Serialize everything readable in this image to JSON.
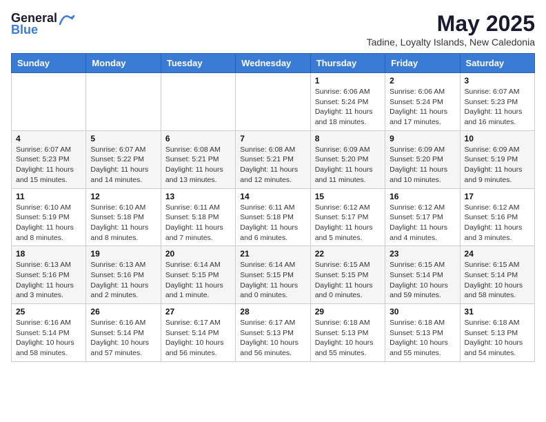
{
  "logo": {
    "general": "General",
    "blue": "Blue"
  },
  "header": {
    "month_title": "May 2025",
    "subtitle": "Tadine, Loyalty Islands, New Caledonia"
  },
  "weekdays": [
    "Sunday",
    "Monday",
    "Tuesday",
    "Wednesday",
    "Thursday",
    "Friday",
    "Saturday"
  ],
  "weeks": [
    [
      {
        "day": "",
        "sunrise": "",
        "sunset": "",
        "daylight": ""
      },
      {
        "day": "",
        "sunrise": "",
        "sunset": "",
        "daylight": ""
      },
      {
        "day": "",
        "sunrise": "",
        "sunset": "",
        "daylight": ""
      },
      {
        "day": "",
        "sunrise": "",
        "sunset": "",
        "daylight": ""
      },
      {
        "day": "1",
        "sunrise": "Sunrise: 6:06 AM",
        "sunset": "Sunset: 5:24 PM",
        "daylight": "Daylight: 11 hours and 18 minutes."
      },
      {
        "day": "2",
        "sunrise": "Sunrise: 6:06 AM",
        "sunset": "Sunset: 5:24 PM",
        "daylight": "Daylight: 11 hours and 17 minutes."
      },
      {
        "day": "3",
        "sunrise": "Sunrise: 6:07 AM",
        "sunset": "Sunset: 5:23 PM",
        "daylight": "Daylight: 11 hours and 16 minutes."
      }
    ],
    [
      {
        "day": "4",
        "sunrise": "Sunrise: 6:07 AM",
        "sunset": "Sunset: 5:23 PM",
        "daylight": "Daylight: 11 hours and 15 minutes."
      },
      {
        "day": "5",
        "sunrise": "Sunrise: 6:07 AM",
        "sunset": "Sunset: 5:22 PM",
        "daylight": "Daylight: 11 hours and 14 minutes."
      },
      {
        "day": "6",
        "sunrise": "Sunrise: 6:08 AM",
        "sunset": "Sunset: 5:21 PM",
        "daylight": "Daylight: 11 hours and 13 minutes."
      },
      {
        "day": "7",
        "sunrise": "Sunrise: 6:08 AM",
        "sunset": "Sunset: 5:21 PM",
        "daylight": "Daylight: 11 hours and 12 minutes."
      },
      {
        "day": "8",
        "sunrise": "Sunrise: 6:09 AM",
        "sunset": "Sunset: 5:20 PM",
        "daylight": "Daylight: 11 hours and 11 minutes."
      },
      {
        "day": "9",
        "sunrise": "Sunrise: 6:09 AM",
        "sunset": "Sunset: 5:20 PM",
        "daylight": "Daylight: 11 hours and 10 minutes."
      },
      {
        "day": "10",
        "sunrise": "Sunrise: 6:09 AM",
        "sunset": "Sunset: 5:19 PM",
        "daylight": "Daylight: 11 hours and 9 minutes."
      }
    ],
    [
      {
        "day": "11",
        "sunrise": "Sunrise: 6:10 AM",
        "sunset": "Sunset: 5:19 PM",
        "daylight": "Daylight: 11 hours and 8 minutes."
      },
      {
        "day": "12",
        "sunrise": "Sunrise: 6:10 AM",
        "sunset": "Sunset: 5:18 PM",
        "daylight": "Daylight: 11 hours and 8 minutes."
      },
      {
        "day": "13",
        "sunrise": "Sunrise: 6:11 AM",
        "sunset": "Sunset: 5:18 PM",
        "daylight": "Daylight: 11 hours and 7 minutes."
      },
      {
        "day": "14",
        "sunrise": "Sunrise: 6:11 AM",
        "sunset": "Sunset: 5:18 PM",
        "daylight": "Daylight: 11 hours and 6 minutes."
      },
      {
        "day": "15",
        "sunrise": "Sunrise: 6:12 AM",
        "sunset": "Sunset: 5:17 PM",
        "daylight": "Daylight: 11 hours and 5 minutes."
      },
      {
        "day": "16",
        "sunrise": "Sunrise: 6:12 AM",
        "sunset": "Sunset: 5:17 PM",
        "daylight": "Daylight: 11 hours and 4 minutes."
      },
      {
        "day": "17",
        "sunrise": "Sunrise: 6:12 AM",
        "sunset": "Sunset: 5:16 PM",
        "daylight": "Daylight: 11 hours and 3 minutes."
      }
    ],
    [
      {
        "day": "18",
        "sunrise": "Sunrise: 6:13 AM",
        "sunset": "Sunset: 5:16 PM",
        "daylight": "Daylight: 11 hours and 3 minutes."
      },
      {
        "day": "19",
        "sunrise": "Sunrise: 6:13 AM",
        "sunset": "Sunset: 5:16 PM",
        "daylight": "Daylight: 11 hours and 2 minutes."
      },
      {
        "day": "20",
        "sunrise": "Sunrise: 6:14 AM",
        "sunset": "Sunset: 5:15 PM",
        "daylight": "Daylight: 11 hours and 1 minute."
      },
      {
        "day": "21",
        "sunrise": "Sunrise: 6:14 AM",
        "sunset": "Sunset: 5:15 PM",
        "daylight": "Daylight: 11 hours and 0 minutes."
      },
      {
        "day": "22",
        "sunrise": "Sunrise: 6:15 AM",
        "sunset": "Sunset: 5:15 PM",
        "daylight": "Daylight: 11 hours and 0 minutes."
      },
      {
        "day": "23",
        "sunrise": "Sunrise: 6:15 AM",
        "sunset": "Sunset: 5:14 PM",
        "daylight": "Daylight: 10 hours and 59 minutes."
      },
      {
        "day": "24",
        "sunrise": "Sunrise: 6:15 AM",
        "sunset": "Sunset: 5:14 PM",
        "daylight": "Daylight: 10 hours and 58 minutes."
      }
    ],
    [
      {
        "day": "25",
        "sunrise": "Sunrise: 6:16 AM",
        "sunset": "Sunset: 5:14 PM",
        "daylight": "Daylight: 10 hours and 58 minutes."
      },
      {
        "day": "26",
        "sunrise": "Sunrise: 6:16 AM",
        "sunset": "Sunset: 5:14 PM",
        "daylight": "Daylight: 10 hours and 57 minutes."
      },
      {
        "day": "27",
        "sunrise": "Sunrise: 6:17 AM",
        "sunset": "Sunset: 5:14 PM",
        "daylight": "Daylight: 10 hours and 56 minutes."
      },
      {
        "day": "28",
        "sunrise": "Sunrise: 6:17 AM",
        "sunset": "Sunset: 5:13 PM",
        "daylight": "Daylight: 10 hours and 56 minutes."
      },
      {
        "day": "29",
        "sunrise": "Sunrise: 6:18 AM",
        "sunset": "Sunset: 5:13 PM",
        "daylight": "Daylight: 10 hours and 55 minutes."
      },
      {
        "day": "30",
        "sunrise": "Sunrise: 6:18 AM",
        "sunset": "Sunset: 5:13 PM",
        "daylight": "Daylight: 10 hours and 55 minutes."
      },
      {
        "day": "31",
        "sunrise": "Sunrise: 6:18 AM",
        "sunset": "Sunset: 5:13 PM",
        "daylight": "Daylight: 10 hours and 54 minutes."
      }
    ]
  ]
}
